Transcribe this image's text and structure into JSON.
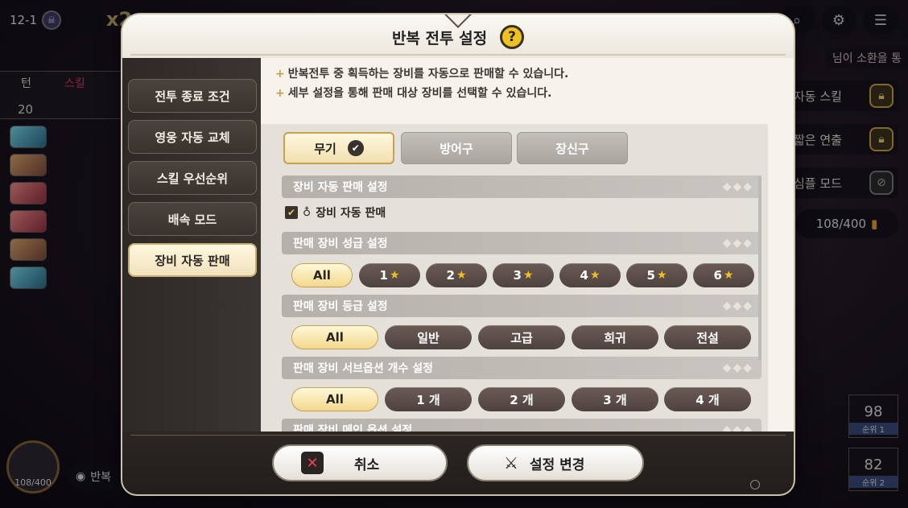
{
  "background": {
    "stage": "12-1",
    "speed": "x2",
    "turn_label": "턴",
    "skill_label": "스킬",
    "turn_count": "20",
    "summon_text": "님이 소환을 통",
    "auto_skill_label": "자동 스킬",
    "short_effect_label": "짧은 연출",
    "simple_mode_label": "심플 모드",
    "count_right": "108/400",
    "rank1_value": "98",
    "rank1_label": "순위 1",
    "rank2_value": "82",
    "rank2_label": "순위 2",
    "count_left": "108/400",
    "repeat_label": "반복"
  },
  "modal": {
    "title": "반복 전투 설정",
    "help_label": "?",
    "side_menu": [
      {
        "label": "전투 종료 조건",
        "active": false
      },
      {
        "label": "영웅 자동 교체",
        "active": false
      },
      {
        "label": "스킬 우선순위",
        "active": false
      },
      {
        "label": "배속 모드",
        "active": false
      },
      {
        "label": "장비 자동 판매",
        "active": true
      }
    ],
    "notes": [
      "반복전투 중 획득하는 장비를 자동으로 판매할 수 있습니다.",
      "세부 설정을 통해 판매 대상 장비를 선택할 수 있습니다."
    ],
    "note_bullet": "+",
    "tabs": [
      {
        "label": "무기",
        "active": true
      },
      {
        "label": "방어구",
        "active": false
      },
      {
        "label": "장신구",
        "active": false
      }
    ],
    "sections": {
      "auto_sell_title": "장비 자동 판매 설정",
      "auto_sell_checkbox": "장비 자동 판매",
      "auto_sell_checked": true,
      "star_title": "판매 장비 성급 설정",
      "star_options": [
        "All",
        "1",
        "2",
        "3",
        "4",
        "5",
        "6"
      ],
      "grade_title": "판매 장비 등급 설정",
      "grade_options": [
        "All",
        "일반",
        "고급",
        "희귀",
        "전설"
      ],
      "suboption_title": "판매 장비 서브옵션 개수 설정",
      "suboption_options": [
        "All",
        "1 개",
        "2 개",
        "3 개",
        "4 개"
      ],
      "mainoption_title": "판매 장비 메인 옵션 설정"
    },
    "footer": {
      "cancel_label": "취소",
      "confirm_label": "설정 변경"
    }
  },
  "colors": {
    "accent_gold": "#f0c020",
    "active_pill": "#f3d88e",
    "inactive_pill": "#4e4240",
    "dark_panel": "#2e2926",
    "cancel_x": "#e8444c"
  }
}
